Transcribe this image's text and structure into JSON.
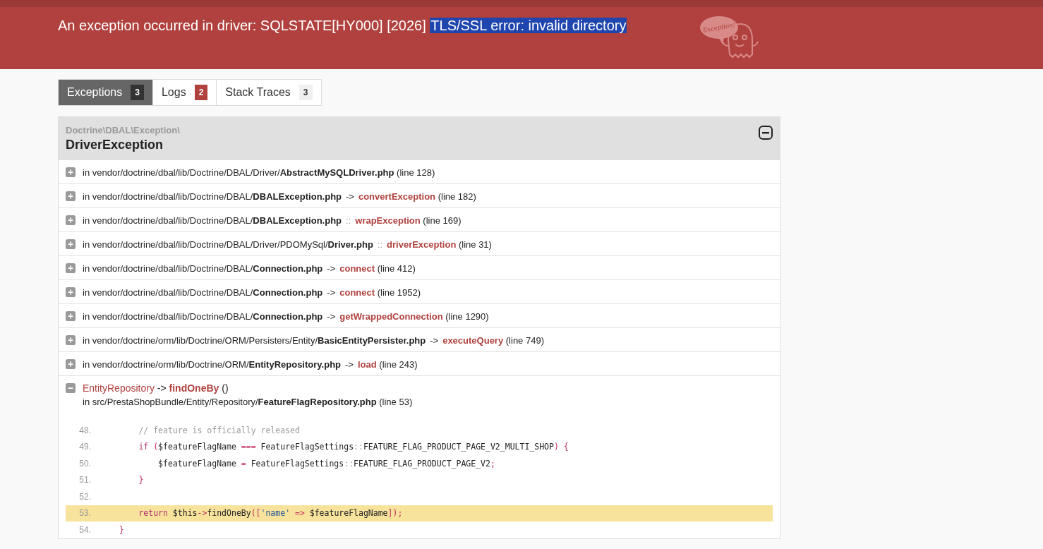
{
  "header": {
    "message": [
      {
        "text": "An exception occurred in driver: SQLSTATE[HY000] [2026] ",
        "selected": false
      },
      {
        "text": "TLS/SSL error: invalid directory",
        "selected": true
      }
    ],
    "mascot_text": "Exception!"
  },
  "tabs": [
    {
      "label": "Exceptions",
      "selected": true,
      "badge": {
        "count": "3",
        "color": "#333333"
      }
    },
    {
      "label": "Logs",
      "selected": false,
      "badge": {
        "count": "2",
        "color": "#b0413e"
      }
    },
    {
      "label": "Stack Traces",
      "selected": false,
      "badge": {
        "count": "3",
        "color": "#f0f0f0"
      }
    }
  ],
  "exception": {
    "namespace": "Doctrine\\DBAL\\Exception\\",
    "class": "DriverException",
    "expanded": true,
    "traces": [
      {
        "path": "in vendor/doctrine/dbal/lib/Doctrine/DBAL/Driver/",
        "file": "AbstractMySQLDriver.php",
        "line": "(line 128)",
        "expanded": false
      },
      {
        "path": "in vendor/doctrine/dbal/lib/Doctrine/DBAL/",
        "file": "DBALException.php",
        "call": "->",
        "function": "convertException",
        "line": "(line 182)",
        "expanded": false
      },
      {
        "path": "in vendor/doctrine/dbal/lib/Doctrine/DBAL/",
        "file": "DBALException.php",
        "call": "::",
        "function": "wrapException",
        "line": "(line 169)",
        "expanded": false
      },
      {
        "path": "in vendor/doctrine/dbal/lib/Doctrine/DBAL/Driver/PDOMySql/",
        "file": "Driver.php",
        "call": "::",
        "function": "driverException",
        "line": "(line 31)",
        "expanded": false
      },
      {
        "path": "in vendor/doctrine/dbal/lib/Doctrine/DBAL/",
        "file": "Connection.php",
        "call": "->",
        "function": "connect",
        "line": "(line 412)",
        "expanded": false
      },
      {
        "path": "in vendor/doctrine/dbal/lib/Doctrine/DBAL/",
        "file": "Connection.php",
        "call": "->",
        "function": "connect",
        "line": "(line 1952)",
        "expanded": false
      },
      {
        "path": "in vendor/doctrine/dbal/lib/Doctrine/DBAL/",
        "file": "Connection.php",
        "call": "->",
        "function": "getWrappedConnection",
        "line": "(line 1290)",
        "expanded": false
      },
      {
        "path": "in vendor/doctrine/orm/lib/Doctrine/ORM/Persisters/Entity/",
        "file": "BasicEntityPersister.php",
        "call": "->",
        "function": "executeQuery",
        "line": "(line 749)",
        "expanded": false
      },
      {
        "path": "in vendor/doctrine/orm/lib/Doctrine/ORM/",
        "file": "EntityRepository.php",
        "call": "->",
        "function": "load",
        "line": "(line 243)",
        "expanded": false
      },
      {
        "class": "EntityRepository",
        "call": "->",
        "function": "findOneBy",
        "args": "()",
        "path": "in src/PrestaShopBundle/Entity/Repository/",
        "file": "FeatureFlagRepository.php",
        "line": "(line 53)",
        "expanded": true,
        "code": [
          {
            "number": "48.",
            "highlighted": false,
            "tokens": [
              {
                "kind": "comment",
                "text": "        // feature is officially released"
              }
            ]
          },
          {
            "number": "49.",
            "highlighted": false,
            "tokens": [
              {
                "kind": "keyword",
                "text": "        if"
              },
              {
                "kind": "op",
                "text": " ("
              },
              {
                "kind": "plain",
                "text": "$featureFlagName "
              },
              {
                "kind": "op",
                "text": "==="
              },
              {
                "kind": "plain",
                "text": " FeatureFlagSettings"
              },
              {
                "kind": "punct",
                "text": "::"
              },
              {
                "kind": "plain",
                "text": "FEATURE_FLAG_PRODUCT_PAGE_V2_MULTI_SHOP"
              },
              {
                "kind": "op",
                "text": ") {"
              }
            ]
          },
          {
            "number": "50.",
            "highlighted": false,
            "tokens": [
              {
                "kind": "plain",
                "text": "            $featureFlagName "
              },
              {
                "kind": "op",
                "text": "="
              },
              {
                "kind": "plain",
                "text": " FeatureFlagSettings"
              },
              {
                "kind": "punct",
                "text": "::"
              },
              {
                "kind": "plain",
                "text": "FEATURE_FLAG_PRODUCT_PAGE_V2"
              },
              {
                "kind": "op",
                "text": ";"
              }
            ]
          },
          {
            "number": "51.",
            "highlighted": false,
            "tokens": [
              {
                "kind": "op",
                "text": "        }"
              }
            ]
          },
          {
            "number": "52.",
            "highlighted": false
          },
          {
            "number": "53.",
            "highlighted": true,
            "tokens": [
              {
                "kind": "keyword",
                "text": "        return"
              },
              {
                "kind": "plain",
                "text": " $this"
              },
              {
                "kind": "op",
                "text": "->"
              },
              {
                "kind": "plain",
                "text": "findOneBy"
              },
              {
                "kind": "op",
                "text": "(["
              },
              {
                "kind": "string",
                "text": "'name'"
              },
              {
                "kind": "op",
                "text": " => "
              },
              {
                "kind": "plain",
                "text": "$featureFlagName"
              },
              {
                "kind": "op",
                "text": "]);"
              }
            ]
          },
          {
            "number": "54.",
            "highlighted": false,
            "tokens": [
              {
                "kind": "op",
                "text": "    }"
              }
            ]
          }
        ]
      }
    ]
  }
}
